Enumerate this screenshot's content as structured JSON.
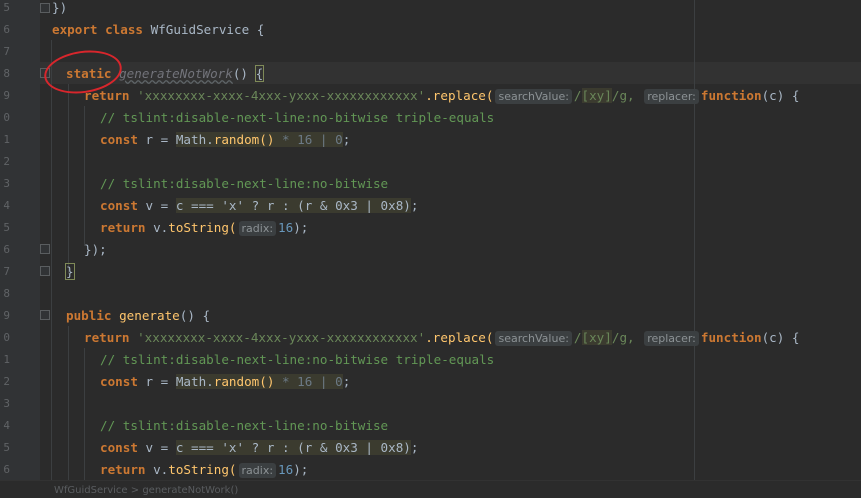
{
  "editor": {
    "line_numbers": [
      "5",
      "6",
      "7",
      "8",
      "9",
      "0",
      "1",
      "2",
      "3",
      "4",
      "5",
      "6",
      "7",
      "8",
      "9",
      "0",
      "1",
      "2",
      "3",
      "4",
      "5",
      "6"
    ],
    "lines": {
      "l0_close": "})",
      "l1_export": "export",
      "l1_class": "class",
      "l1_name": "WfGuidService",
      "l1_brace": "{",
      "static_kw": "static",
      "method1_name": "generateNotWork",
      "method1_parens": "()",
      "method1_brace": "{",
      "return_kw": "return",
      "guid_template": "'xxxxxxxx-xxxx-4xxx-yxxx-xxxxxxxxxxxx'",
      "replace_fn": ".replace(",
      "hint_search": "searchValue:",
      "regex_pre": "/",
      "regex_class": "[xy]",
      "regex_post": "/g,",
      "hint_replacer": "replacer:",
      "function_kw": "function",
      "callback_args": "(c) {",
      "comment_triple": "// tslint:disable-next-line:no-bitwise triple-equals",
      "const_kw": "const",
      "r_assign": " r = ",
      "math_random": "Math.",
      "random_fn": "random",
      "random_parens": "()",
      "times_16_or_0": " * 16 | 0",
      "semicolon": ";",
      "comment_bitwise": "// tslint:disable-next-line:no-bitwise",
      "v_assign": " v = ",
      "ternary": "c === 'x' ? r : (r & 0x3 | 0x8)",
      "return_v": "v.",
      "to_string_fn": "toString(",
      "hint_radix": "radix:",
      "radix_value": "16",
      "close_paren_semi": ");",
      "close_callback": "});",
      "close_brace": "}",
      "public_kw": "public",
      "method2_name": "generate",
      "method2_parens": "()",
      "method2_brace": "{"
    }
  },
  "status_bar": {
    "breadcrumb": "WfGuidService > generateNotWork()"
  },
  "colors": {
    "background": "#2b2b2b",
    "keyword": "#cc7832",
    "string": "#6a8759",
    "function": "#ffc66d",
    "comment": "#629755",
    "number": "#6897bb",
    "annotation": "#d8262c"
  }
}
